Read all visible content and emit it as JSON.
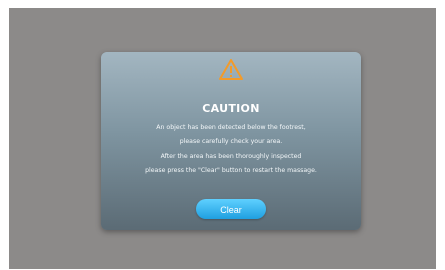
{
  "dialog": {
    "icon": "warning-triangle-icon",
    "accent_color": "#f39b2a",
    "title": "CAUTION",
    "lines": [
      "An object has been detected below the footrest,",
      "please carefully check your area.",
      "After the area has been thoroughly inspected",
      "please press the \"Clear\" button to restart the massage."
    ],
    "button_label": "Clear",
    "button_color": "#2aa9e8"
  }
}
